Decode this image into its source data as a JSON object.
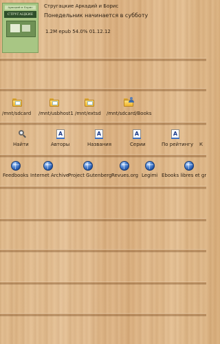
{
  "current_book": {
    "author": "Стругацкие Аркадий и Борис",
    "title": "Понедельник начинается в субботу",
    "info": "1.2M epub  54.0% 01.12.12",
    "cover_top": "Аркадий и Борис",
    "cover_title": "СТРУГАЦКИЕ"
  },
  "storage": [
    {
      "label": "/mnt/sdcard",
      "icon": "folder"
    },
    {
      "label": "/mnt/usbhost1",
      "icon": "folder"
    },
    {
      "label": "/mnt/extsd",
      "icon": "folder"
    },
    {
      "label": "/mnt/sdcard/Books",
      "icon": "folder-user"
    }
  ],
  "search": [
    {
      "label": "Найти",
      "icon": "search",
      "glyph": ""
    },
    {
      "label": "Авторы",
      "icon": "letter-a",
      "glyph": "A"
    },
    {
      "label": "Названия",
      "icon": "letter-a",
      "glyph": "A"
    },
    {
      "label": "Серии",
      "icon": "letter-a",
      "glyph": "A"
    },
    {
      "label": "По рейтингу",
      "icon": "letter-a",
      "glyph": "A"
    },
    {
      "label": "К",
      "icon": "letter-a",
      "glyph": ""
    }
  ],
  "online": [
    {
      "label": "Feedbooks",
      "icon": "globe"
    },
    {
      "label": "Internet Archive",
      "icon": "globe"
    },
    {
      "label": "Project Gutenberg",
      "icon": "globe"
    },
    {
      "label": "Revues.org",
      "icon": "globe"
    },
    {
      "label": "Legimi",
      "icon": "globe"
    },
    {
      "label": "Ebooks libres et gr",
      "icon": "globe"
    }
  ]
}
